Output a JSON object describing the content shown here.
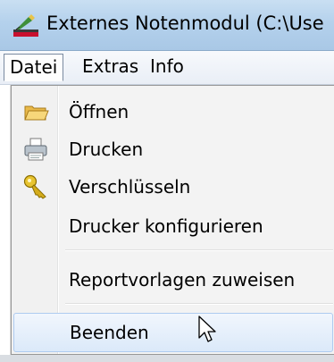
{
  "window": {
    "title": "Externes Notenmodul (C:\\Use"
  },
  "menubar": {
    "items": [
      {
        "label": "Datei",
        "open": true
      },
      {
        "label": "Extras",
        "open": false
      },
      {
        "label": "Info",
        "open": false
      }
    ]
  },
  "dropdown": {
    "items": [
      {
        "label": "Öffnen",
        "icon": "folder-icon"
      },
      {
        "label": "Drucken",
        "icon": "printer-icon"
      },
      {
        "label": "Verschlüsseln",
        "icon": "key-icon"
      },
      {
        "label": "Drucker konfigurieren",
        "icon": null
      },
      {
        "label": "Reportvorlagen zuweisen",
        "icon": null
      },
      {
        "label": "Beenden",
        "icon": null,
        "hovered": true
      }
    ]
  },
  "colors": {
    "titlebar": "#b4d1ec",
    "hover_fill": "#dbe9f9",
    "hover_border": "#aecbf0"
  }
}
